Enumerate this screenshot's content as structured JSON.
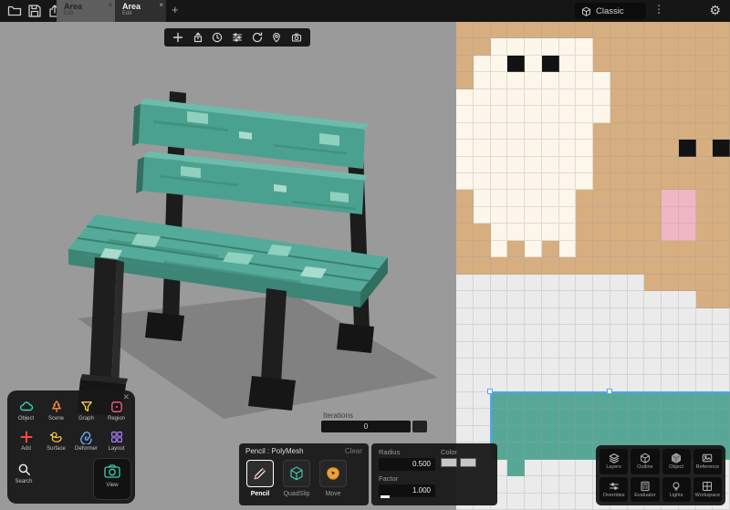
{
  "topbar": {
    "left_icons": [
      "folder-icon",
      "save-icon",
      "export-icon"
    ],
    "tabs": [
      {
        "label": "Area",
        "subtitle": "Edit",
        "close": "×"
      },
      {
        "label": "Area",
        "subtitle": "Edit",
        "close": "×"
      }
    ],
    "new_tab_label": "+",
    "preset_button": {
      "label": "Classic",
      "icon": "cube-icon"
    },
    "menu_icon": "⋮",
    "settings_icon": "⚙"
  },
  "viewport": {
    "toolbar_icons": [
      "add-icon",
      "share-icon",
      "clock-icon",
      "sliders-icon",
      "rotate-icon",
      "pin-icon",
      "camera-icon"
    ],
    "bench_colors": {
      "teal": "#4ba190",
      "teal_light": "#6cbcab",
      "teal_dark": "#3c8577",
      "black": "#1c1c1c",
      "shadow": "#818181",
      "background": "#9a9a9a"
    }
  },
  "tools_panel": {
    "close_icon": "✕",
    "items": [
      {
        "label": "Object",
        "icon": "cloud-icon",
        "color": "#3fd0af"
      },
      {
        "label": "Scene",
        "icon": "tree-icon",
        "color": "#ff8a3d"
      },
      {
        "label": "Graph",
        "icon": "funnel-icon",
        "color": "#ffd23f"
      },
      {
        "label": "Region",
        "icon": "region-icon",
        "color": "#ff5d8a"
      },
      {
        "label": "Add",
        "icon": "plus-icon",
        "color": "#ff4646"
      },
      {
        "label": "Surface",
        "icon": "duck-icon",
        "color": "#ffd23f"
      },
      {
        "label": "Deformer",
        "icon": "spiral-icon",
        "color": "#6fb3ff"
      },
      {
        "label": "Layout",
        "icon": "layout-icon",
        "color": "#b07bff"
      }
    ],
    "search": {
      "label": "Search",
      "icon": "search-icon"
    },
    "view": {
      "label": "View",
      "icon": "camera-icon",
      "color": "#3fd0af"
    }
  },
  "iterations": {
    "label": "Iterations",
    "value": "0"
  },
  "pencil_panel": {
    "title": "Pencil : PolyMesh",
    "clear_label": "Clear",
    "tools": [
      {
        "label": "Pencil",
        "icon": "pencil-icon",
        "selected": true
      },
      {
        "label": "QuadSlip",
        "icon": "cube-icon",
        "selected": false
      },
      {
        "label": "Move",
        "icon": "move-icon",
        "selected": false
      }
    ]
  },
  "brush_settings": {
    "radius_label": "Radius",
    "radius_value": "0.500",
    "factor_label": "Factor",
    "factor_value": "1.000",
    "color_label": "Color"
  },
  "right_dock": {
    "buttons": [
      {
        "label": "Layers",
        "icon": "layers-icon"
      },
      {
        "label": "Outline",
        "icon": "outline-icon"
      },
      {
        "label": "Object",
        "icon": "cube-icon"
      },
      {
        "label": "Reference",
        "icon": "image-icon"
      },
      {
        "label": "Overrides",
        "icon": "overrides-icon"
      },
      {
        "label": "Evaluator",
        "icon": "evaluator-icon"
      },
      {
        "label": "Lights",
        "icon": "light-icon"
      },
      {
        "label": "Workspace",
        "icon": "workspace-icon"
      }
    ]
  },
  "texture_editor": {
    "palette": {
      "t": "#d6ae80",
      "w": "#fcf6eb",
      "b": "#121212",
      "p": "#f0b6c3",
      "g": "#57a796",
      "l": "#ebebeb"
    },
    "rows": [
      "tttttttttttttttt",
      "ttwwwwwwtttttttt",
      "twwbwbwwtttttttt",
      "twwwwwwwwttttttt",
      "wwwwwwwwwttttttt",
      "wwwwwwwwwttttttt",
      "wwwwwwwwtttttttt",
      "wwwwwwwwtttttbtb",
      "wwwwwwwwtttttttt",
      "wwwwwwwwtttttttt",
      "twwwwwwtttttpptt",
      "twwwwwwtttttpptt",
      "ttwwwwwtttttpptt",
      "ttwtwtwttttttttt",
      "tttttttttttttttt",
      "lllllllllllttttt",
      "lllllllllllllltt",
      "llllllllllllllll",
      "llllllllllllllll",
      "llllllllllllllll",
      "llllllllllllllll",
      "llllllllllllllll",
      "llgggggggggggggg",
      "llgggggggggggggg",
      "llgggggggggggggg",
      "llgggggggggggggg",
      "lllgllllllllllll",
      "llllllllllllllll",
      "llllllllllllllll"
    ],
    "selection_color": "#4da3ff"
  }
}
